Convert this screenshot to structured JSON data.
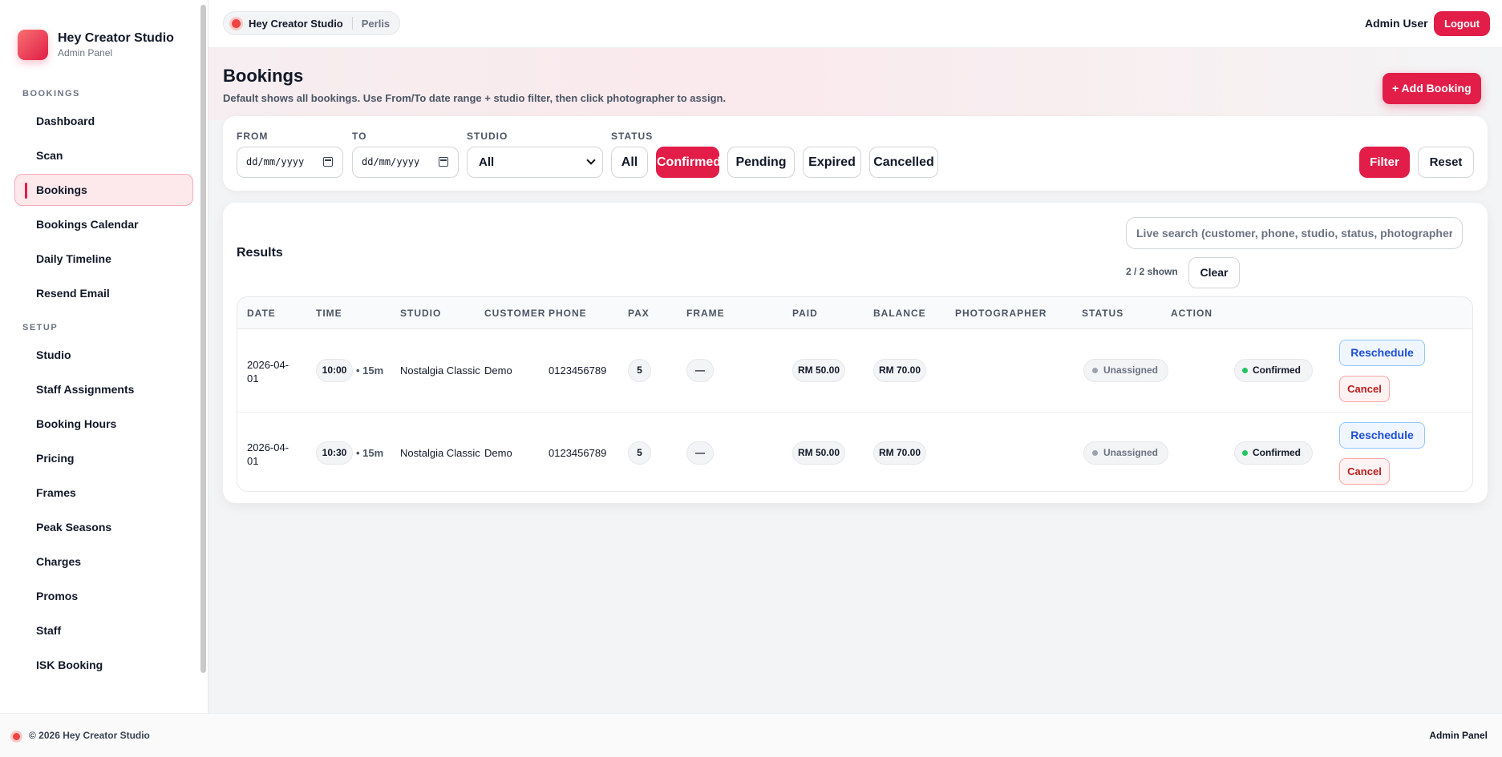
{
  "brand": {
    "title": "Hey Creator Studio",
    "subtitle": "Admin Panel"
  },
  "sidebar": {
    "sections": [
      {
        "label": "BOOKINGS",
        "items": [
          "Dashboard",
          "Scan",
          "Bookings",
          "Bookings Calendar",
          "Daily Timeline",
          "Resend Email"
        ]
      },
      {
        "label": "SETUP",
        "items": [
          "Studio",
          "Staff Assignments",
          "Booking Hours",
          "Pricing",
          "Frames",
          "Peak Seasons",
          "Charges",
          "Promos",
          "Staff",
          "ISK Booking"
        ]
      }
    ],
    "active": "Bookings"
  },
  "topbar": {
    "studio": "Hey Creator Studio",
    "location": "Perlis",
    "user": "Admin User",
    "logout": "Logout"
  },
  "header": {
    "title": "Bookings",
    "subtitle": "Default shows all bookings. Use From/To date range + studio filter, then click photographer to assign.",
    "add_button": "+ Add Booking"
  },
  "filters": {
    "from_label": "FROM",
    "from_value": "dd/mm/yyyy",
    "to_label": "TO",
    "to_value": "dd/mm/yyyy",
    "studio_label": "STUDIO",
    "studio_value": "All",
    "status_label": "STATUS",
    "status_options": [
      "All",
      "Confirmed",
      "Pending",
      "Expired",
      "Cancelled"
    ],
    "status_selected": "Confirmed",
    "filter_button": "Filter",
    "reset_button": "Reset"
  },
  "results": {
    "title": "Results",
    "search_placeholder": "Live search (customer, phone, studio, status, photographer)",
    "shown": "2 / 2 shown",
    "clear_button": "Clear",
    "columns": [
      "DATE",
      "TIME",
      "STUDIO",
      "CUSTOMER",
      "PHONE",
      "PAX",
      "FRAME",
      "PAID",
      "BALANCE",
      "PHOTOGRAPHER",
      "STATUS",
      "ACTION"
    ],
    "rows": [
      {
        "date": "2026-04-01",
        "time": "10:00",
        "duration": "• 15m",
        "studio": "Nostalgia Classic",
        "customer": "Demo",
        "phone": "0123456789",
        "pax": "5",
        "frame": "—",
        "paid": "RM 50.00",
        "balance": "RM 70.00",
        "photographer": "Unassigned",
        "status": "Confirmed",
        "reschedule": "Reschedule",
        "cancel": "Cancel"
      },
      {
        "date": "2026-04-01",
        "time": "10:30",
        "duration": "• 15m",
        "studio": "Nostalgia Classic",
        "customer": "Demo",
        "phone": "0123456789",
        "pax": "5",
        "frame": "—",
        "paid": "RM 50.00",
        "balance": "RM 70.00",
        "photographer": "Unassigned",
        "status": "Confirmed",
        "reschedule": "Reschedule",
        "cancel": "Cancel"
      }
    ]
  },
  "footer": {
    "copyright": "© 2026   Hey Creator Studio",
    "right": "Admin Panel"
  }
}
